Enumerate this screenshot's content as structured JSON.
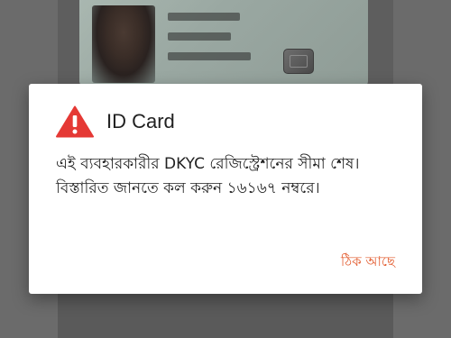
{
  "dialog": {
    "title": "ID Card",
    "icon": "warning-icon",
    "message": "এই ব্যবহারকারীর DKYC রেজিস্ট্রেশনের সীমা শেষ। বিস্তারিত জানতে কল করুন ১৬১৬৭ নম্বরে।",
    "ok_label": "ঠিক আছে"
  },
  "colors": {
    "warning_red": "#e53935",
    "button_accent": "#e2582a",
    "overlay": "#6b6b6b"
  }
}
